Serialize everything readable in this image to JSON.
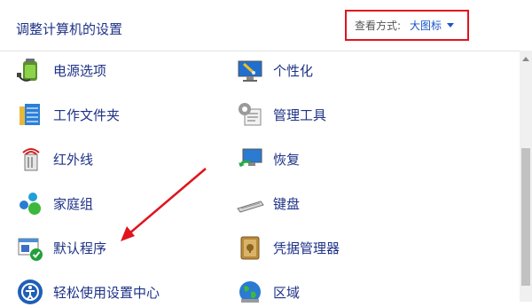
{
  "header": {
    "title": "调整计算机的设置",
    "view_label": "查看方式:",
    "view_value": "大图标"
  },
  "items": {
    "power": {
      "label": "电源选项",
      "icon": "power-options-icon"
    },
    "personalization": {
      "label": "个性化",
      "icon": "personalization-icon"
    },
    "work_folders": {
      "label": "工作文件夹",
      "icon": "work-folders-icon"
    },
    "admin_tools": {
      "label": "管理工具",
      "icon": "administrative-tools-icon"
    },
    "infrared": {
      "label": "红外线",
      "icon": "infrared-icon"
    },
    "recovery": {
      "label": "恢复",
      "icon": "recovery-icon"
    },
    "homegroup": {
      "label": "家庭组",
      "icon": "homegroup-icon"
    },
    "keyboard": {
      "label": "键盘",
      "icon": "keyboard-icon"
    },
    "default_programs": {
      "label": "默认程序",
      "icon": "default-programs-icon"
    },
    "credential_manager": {
      "label": "凭据管理器",
      "icon": "credential-manager-icon"
    },
    "ease_of_access": {
      "label": "轻松使用设置中心",
      "icon": "ease-of-access-icon"
    },
    "region": {
      "label": "区域",
      "icon": "region-icon"
    }
  },
  "colors": {
    "link": "#1e3287",
    "accent": "#1a56c8",
    "highlight_box": "#e0141e",
    "annotation_arrow": "#e0141e"
  }
}
